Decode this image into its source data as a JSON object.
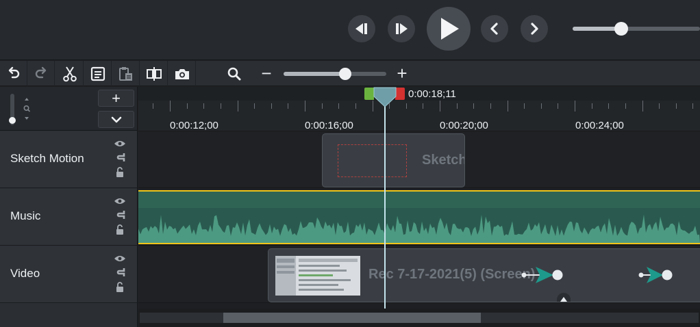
{
  "transport": {
    "scrub_fraction": 0.38,
    "icons": [
      "step-back-icon",
      "step-forward-icon",
      "play-icon",
      "previous-marker-icon",
      "next-marker-icon"
    ]
  },
  "toolbar": {
    "icons": [
      "undo-icon",
      "redo-icon",
      "scissors-icon",
      "copy-icon",
      "paste-icon",
      "split-icon",
      "camera-icon",
      "zoom-magnifier-icon"
    ],
    "zoom_minus": "−",
    "zoom_plus": "+",
    "zoom_fraction": 0.6
  },
  "track_headers": {
    "add_label": "+",
    "height_fraction": 0.85
  },
  "tracks": [
    {
      "name": "Sketch Motion"
    },
    {
      "name": "Music"
    },
    {
      "name": "Video"
    }
  ],
  "ruler": {
    "labels": [
      "0:00:12;00",
      "0:00:16;00",
      "0:00:20;00",
      "0:00:24;00"
    ],
    "playhead_time": "0:00:18;11"
  },
  "clips": {
    "sketch_name": "Sketch",
    "video_name": "Rec 7-17-2021(5) (Screen)"
  },
  "colors": {
    "selection_start": "#6bb33f",
    "selection_end": "#d43131",
    "music_border": "#f0c419",
    "audio_wave": "#4d9a82",
    "playhead": "#c6e5ee",
    "animation_arrow": "#1e9a8c"
  },
  "scrollbar": {
    "thumb_start_fraction": 0.15,
    "thumb_length_fraction": 0.46
  }
}
